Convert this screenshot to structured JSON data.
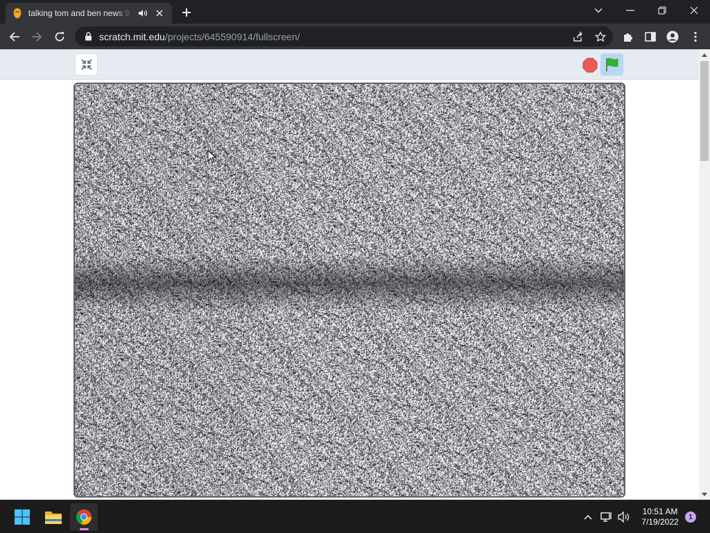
{
  "browser": {
    "tab": {
      "title": "talking tom and ben news 9:",
      "favicon": "scratch-cat-icon"
    },
    "address_bar": {
      "host": "scratch.mit.edu",
      "path": "/projects/645590914/fullscreen/"
    }
  },
  "player": {
    "buttons": {
      "exit_fullscreen": "unfullscreen-icon",
      "stop": "stop-icon",
      "green_flag": "green-flag-icon"
    },
    "stage_content": "tv static noise",
    "colors": {
      "stop": "#ec5959",
      "flag": "#2fb52f",
      "flag_button_bg": "#b9d7f5",
      "controls_bg": "#e6eaf1"
    }
  },
  "taskbar": {
    "clock": {
      "time": "10:51 AM",
      "date": "7/19/2022"
    },
    "notification_count": "1"
  }
}
